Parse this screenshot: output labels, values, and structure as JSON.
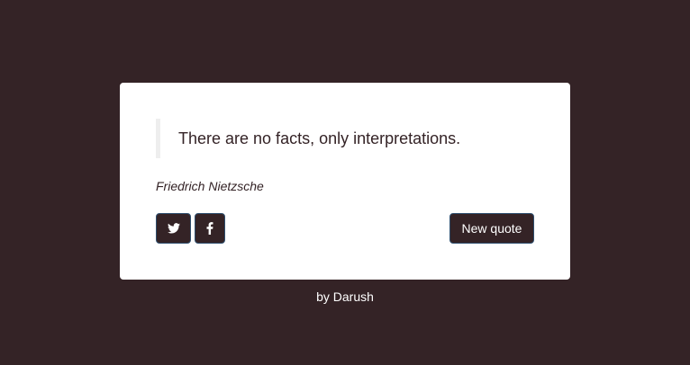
{
  "quote": {
    "text": "There are no facts, only interpretations.",
    "author": "Friedrich Nietzsche"
  },
  "actions": {
    "twitter_icon": "twitter-icon",
    "facebook_icon": "facebook-icon",
    "new_quote_label": "New quote"
  },
  "footer": {
    "text": "by Darush"
  },
  "colors": {
    "background": "#342326",
    "card": "#ffffff",
    "button": "#342326",
    "quote_border": "#eeeeee"
  }
}
